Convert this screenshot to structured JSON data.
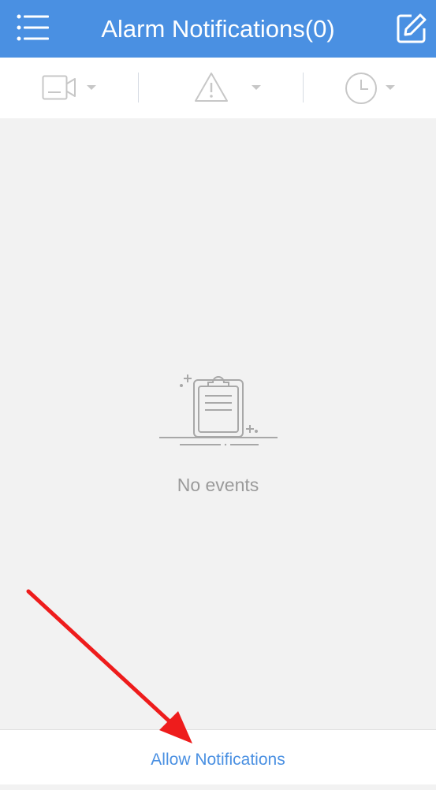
{
  "header": {
    "title": "Alarm Notifications(0)",
    "menu_icon": "menu-list-icon",
    "edit_icon": "edit-icon"
  },
  "filters": [
    {
      "icon": "camera-icon",
      "label": "Camera filter"
    },
    {
      "icon": "alert-triangle-icon",
      "label": "Alarm type filter"
    },
    {
      "icon": "clock-icon",
      "label": "Time filter"
    }
  ],
  "empty_state": {
    "icon": "clipboard-icon",
    "message": "No events"
  },
  "footer": {
    "allow_label": "Allow Notifications"
  },
  "colors": {
    "header_bg": "#4a90e2",
    "accent": "#4a90e2",
    "page_bg": "#f2f2f2",
    "icon_grey": "#c7c7c7",
    "annotation_red": "#ee1c1c"
  }
}
